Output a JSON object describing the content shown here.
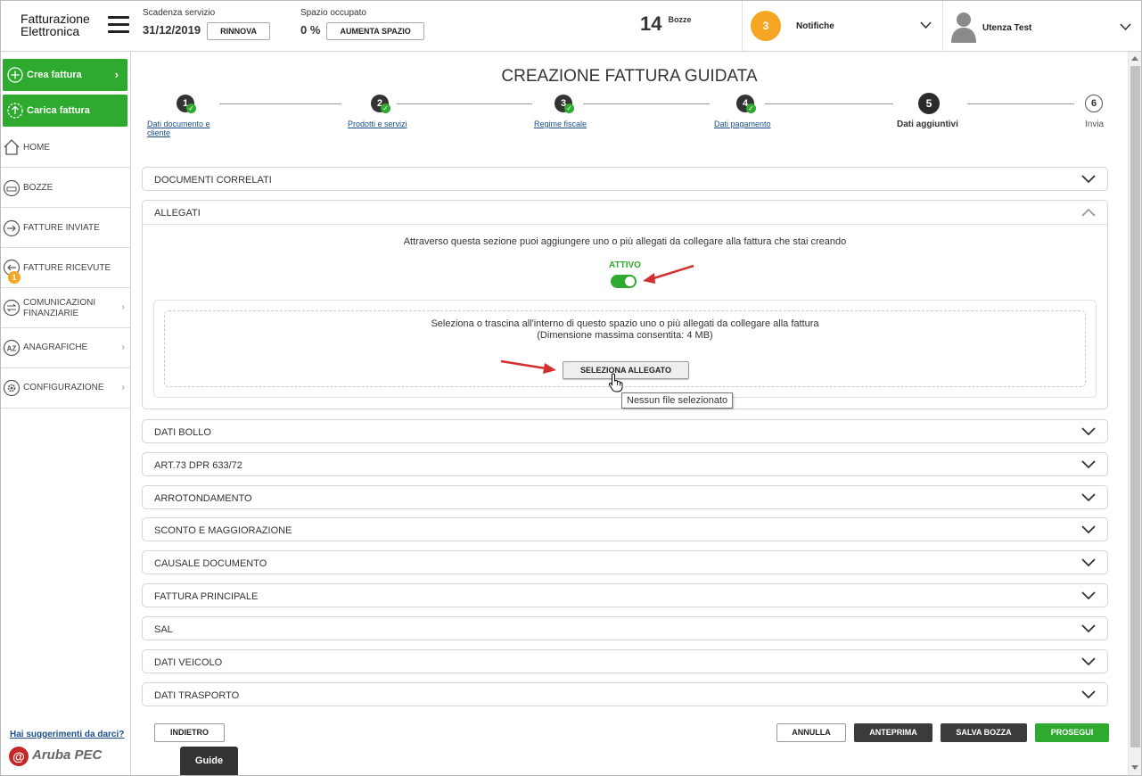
{
  "header": {
    "logo_line1": "Fatturazione",
    "logo_line2": "Elettronica",
    "scadenza_label": "Scadenza servizio",
    "scadenza_value": "31/12/2019",
    "rinnova_label": "RINNOVA",
    "spazio_label": "Spazio occupato",
    "spazio_value": "0 %",
    "aumenta_label": "AUMENTA SPAZIO",
    "bozze_count": "14",
    "bozze_label": "Bozze",
    "notif_count": "3",
    "notif_label": "Notifiche",
    "user_label": "Utenza Test"
  },
  "sidebar": {
    "crea_label": "Crea fattura",
    "carica_label": "Carica fattura",
    "items": [
      {
        "label": "HOME",
        "icon": "home-icon"
      },
      {
        "label": "BOZZE",
        "icon": "drafts-icon"
      },
      {
        "label": "FATTURE INVIATE",
        "icon": "sent-icon"
      },
      {
        "label": "FATTURE RICEVUTE",
        "icon": "received-icon",
        "badge": "1"
      },
      {
        "label1": "COMUNICAZIONI",
        "label2": "FINANZIARIE",
        "icon": "finance-icon"
      },
      {
        "label": "ANAGRAFICHE",
        "icon": "az-icon"
      },
      {
        "label": "CONFIGURAZIONE",
        "icon": "gear-icon"
      }
    ],
    "suggest_label": "Hai suggerimenti da darci?",
    "brand_label": "Aruba PEC"
  },
  "main": {
    "title": "CREAZIONE FATTURA GUIDATA",
    "steps": [
      {
        "num": "1",
        "label1": "Dati documento e",
        "label2": "cliente",
        "state": "done"
      },
      {
        "num": "2",
        "label": "Prodotti e servizi",
        "state": "done"
      },
      {
        "num": "3",
        "label": "Regime fiscale",
        "state": "done"
      },
      {
        "num": "4",
        "label": "Dati pagamento",
        "state": "done"
      },
      {
        "num": "5",
        "label": "Dati aggiuntivi",
        "state": "active"
      },
      {
        "num": "6",
        "label": "Invia",
        "state": "todo"
      }
    ],
    "sections": {
      "documenti_correlati": "DOCUMENTI CORRELATI",
      "allegati": "ALLEGATI",
      "dati_bollo": "DATI BOLLO",
      "art73": "ART.73 DPR 633/72",
      "arrotondamento": "ARROTONDAMENTO",
      "sconto": "SCONTO E MAGGIORAZIONE",
      "causale": "CAUSALE DOCUMENTO",
      "fattura_principale": "FATTURA PRINCIPALE",
      "sal": "SAL",
      "dati_veicolo": "DATI VEICOLO",
      "dati_trasporto": "DATI TRASPORTO"
    },
    "allegati": {
      "description": "Attraverso questa sezione puoi aggiungere uno o più allegati da collegare alla fattura che stai creando",
      "toggle_label": "ATTIVO",
      "toggle_on": true,
      "drop_line1": "Seleziona o trascina all'interno di questo spazio uno o più allegati da collegare alla fattura",
      "drop_line2": "(Dimensione massima consentita: 4 MB)",
      "select_label": "SELEZIONA ALLEGATO",
      "tooltip": "Nessun file selezionato"
    },
    "footer": {
      "indietro": "INDIETRO",
      "guide": "Guide",
      "annulla": "ANNULLA",
      "anteprima": "ANTEPRIMA",
      "salva_bozza": "SALVA BOZZA",
      "prosegui": "PROSEGUI"
    }
  },
  "colors": {
    "accent_green": "#2eaa2e",
    "badge_orange": "#f5a623",
    "link_blue": "#1a4f8b",
    "dark_button": "#3b3b3b",
    "annotation_red": "#d32f2f"
  }
}
